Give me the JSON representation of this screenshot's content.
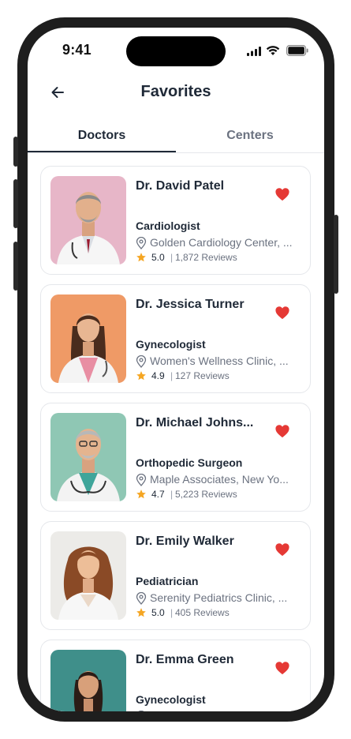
{
  "status_bar": {
    "time": "9:41"
  },
  "header": {
    "title": "Favorites"
  },
  "tabs": [
    {
      "label": "Doctors",
      "active": true
    },
    {
      "label": "Centers",
      "active": false
    }
  ],
  "colors": {
    "heart": "#e53935",
    "star": "#f5a623",
    "text": "#1f2937",
    "muted": "#6b7280"
  },
  "doctors": [
    {
      "name": "Dr. David Patel",
      "specialty": "Cardiologist",
      "location": "Golden Cardiology Center, ...",
      "rating": "5.0",
      "reviews": "1,872 Reviews",
      "favorite": true
    },
    {
      "name": "Dr. Jessica Turner",
      "specialty": "Gynecologist",
      "location": "Women's Wellness Clinic, ...",
      "rating": "4.9",
      "reviews": "127 Reviews",
      "favorite": true
    },
    {
      "name": "Dr. Michael Johns...",
      "specialty": "Orthopedic Surgeon",
      "location": "Maple Associates, New Yo...",
      "rating": "4.7",
      "reviews": "5,223 Reviews",
      "favorite": true
    },
    {
      "name": "Dr. Emily Walker",
      "specialty": "Pediatrician",
      "location": "Serenity Pediatrics Clinic, ...",
      "rating": "5.0",
      "reviews": "405 Reviews",
      "favorite": true
    },
    {
      "name": "Dr. Emma Green",
      "specialty": "Gynecologist",
      "location": "",
      "rating": "",
      "reviews": "",
      "favorite": true
    }
  ]
}
